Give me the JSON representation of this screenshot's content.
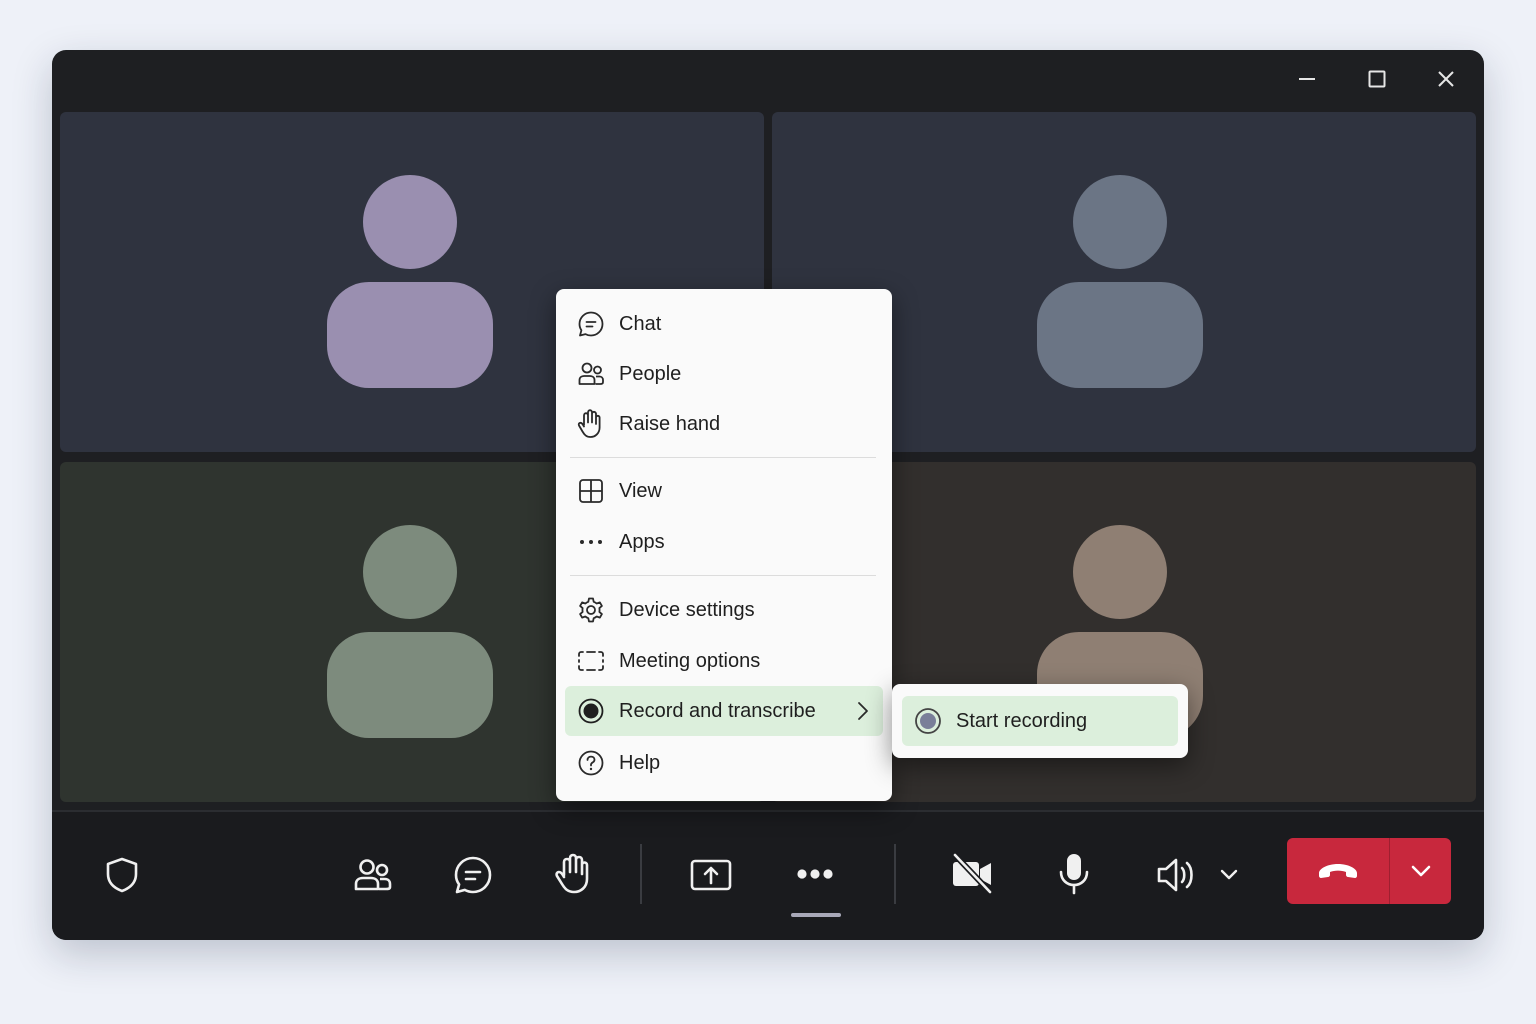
{
  "menu": {
    "items": [
      {
        "label": "Chat",
        "icon": "chat-icon"
      },
      {
        "label": "People",
        "icon": "people-icon"
      },
      {
        "label": "Raise hand",
        "icon": "raise-hand-icon"
      },
      {
        "label": "View",
        "icon": "view-grid-icon"
      },
      {
        "label": "Apps",
        "icon": "apps-ellipsis-icon"
      },
      {
        "label": "Device settings",
        "icon": "gear-icon"
      },
      {
        "label": "Meeting options",
        "icon": "meeting-options-icon"
      },
      {
        "label": "Record and transcribe",
        "icon": "record-icon",
        "active": true,
        "has_submenu": true
      },
      {
        "label": "Help",
        "icon": "help-icon"
      }
    ]
  },
  "submenu": {
    "start_recording_label": "Start recording"
  },
  "participants": [
    {
      "avatar_color": "#9a8fb0",
      "tile_color": "#2f333f"
    },
    {
      "avatar_color": "#6b7585",
      "tile_color": "#2f333f"
    },
    {
      "avatar_color": "#7d8b7d",
      "tile_color": "#2f342f"
    },
    {
      "avatar_color": "#8f7f73",
      "tile_color": "#322f2d"
    }
  ],
  "colors": {
    "accent_green": "#dcefdc",
    "leave_red": "#c8283d",
    "window_bg": "#1e1f22"
  }
}
